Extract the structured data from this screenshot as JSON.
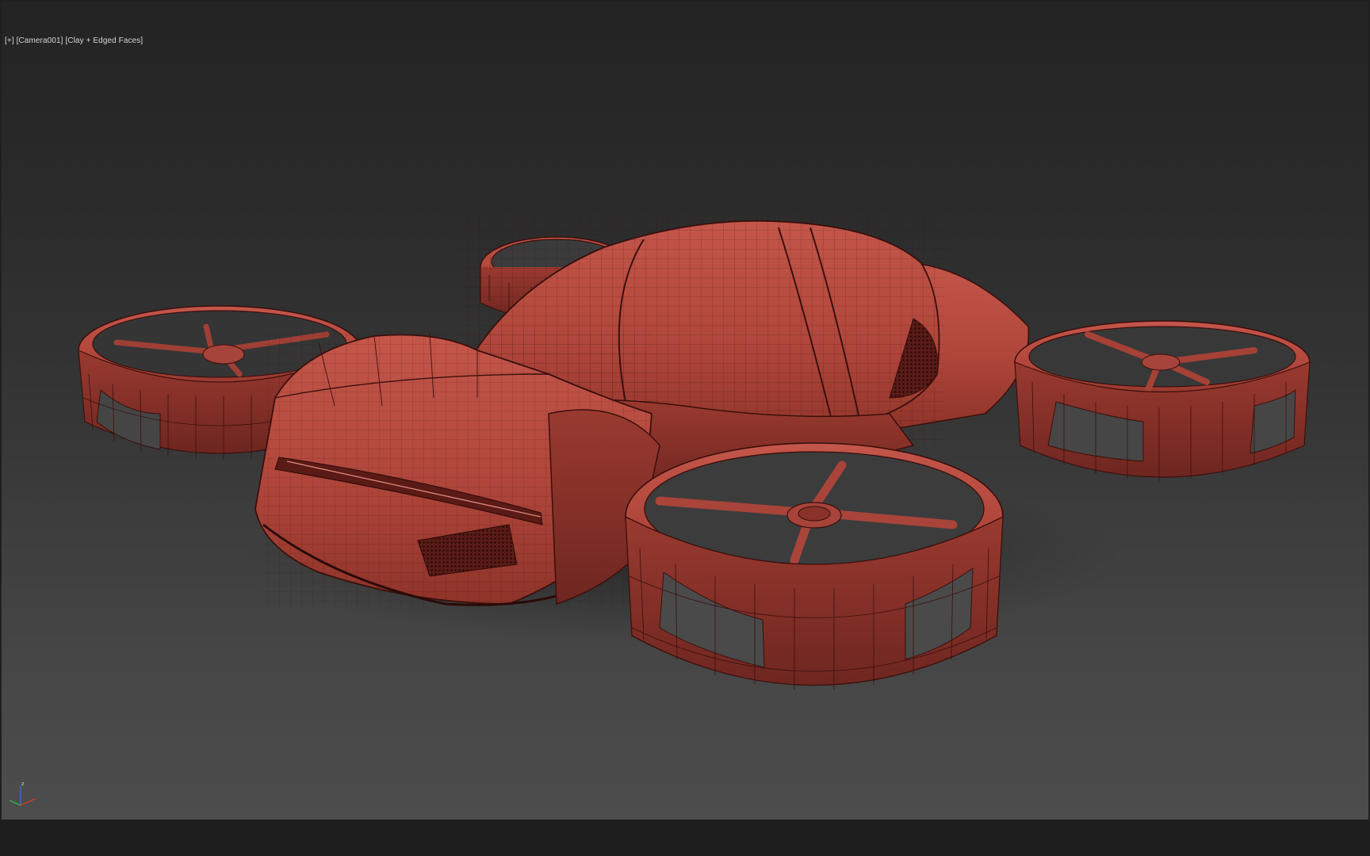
{
  "viewport": {
    "label": {
      "plus": "[+]",
      "camera": "[Camera001]",
      "shading": "[Clay + Edged Faces]"
    },
    "background_top": "#232323",
    "background_bottom": "#4d4d4d"
  },
  "model": {
    "clay_color": "#b44a3f",
    "edge_color": "#3a0f0c"
  },
  "axis_tripod": {
    "z_label": "z",
    "x_color": "#d23a2a",
    "y_color": "#38b04a",
    "z_color": "#3a6fd0"
  }
}
